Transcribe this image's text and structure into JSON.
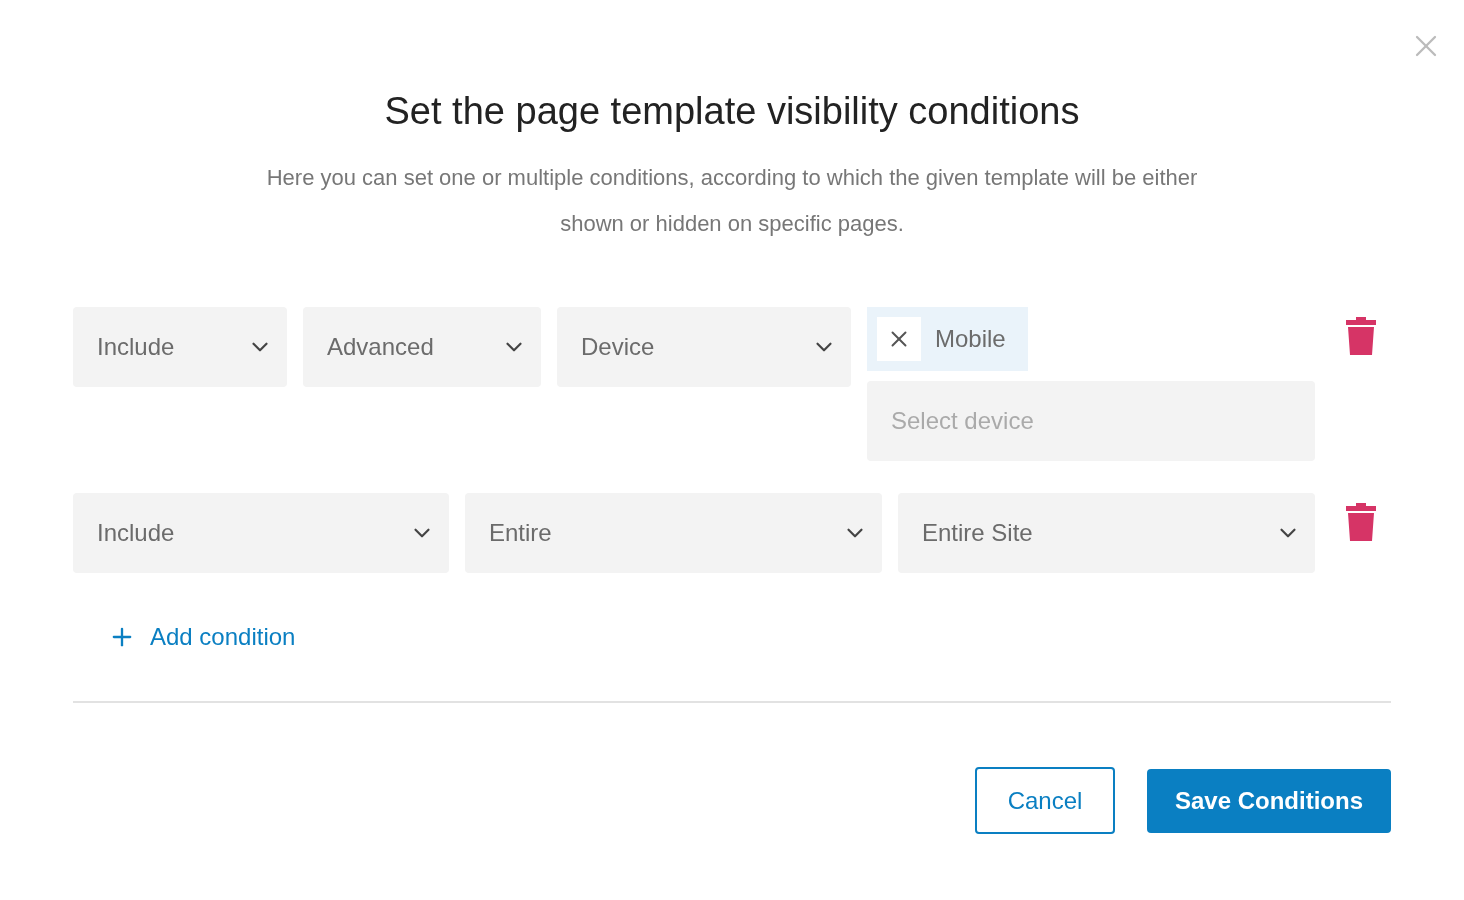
{
  "dialog": {
    "title": "Set the page template visibility conditions",
    "description": "Here you can set one or multiple conditions, according to which the given template will be either shown or hidden on specific pages."
  },
  "conditions": [
    {
      "kind": "advanced",
      "selects": [
        {
          "value": "Include"
        },
        {
          "value": "Advanced"
        },
        {
          "value": "Device"
        }
      ],
      "tags": [
        {
          "label": "Mobile"
        }
      ],
      "placeholder": "Select device"
    },
    {
      "kind": "entire",
      "selects": [
        {
          "value": "Include"
        },
        {
          "value": "Entire"
        },
        {
          "value": "Entire Site"
        }
      ]
    }
  ],
  "add_condition": "Add condition",
  "buttons": {
    "cancel": "Cancel",
    "save": "Save Conditions"
  }
}
